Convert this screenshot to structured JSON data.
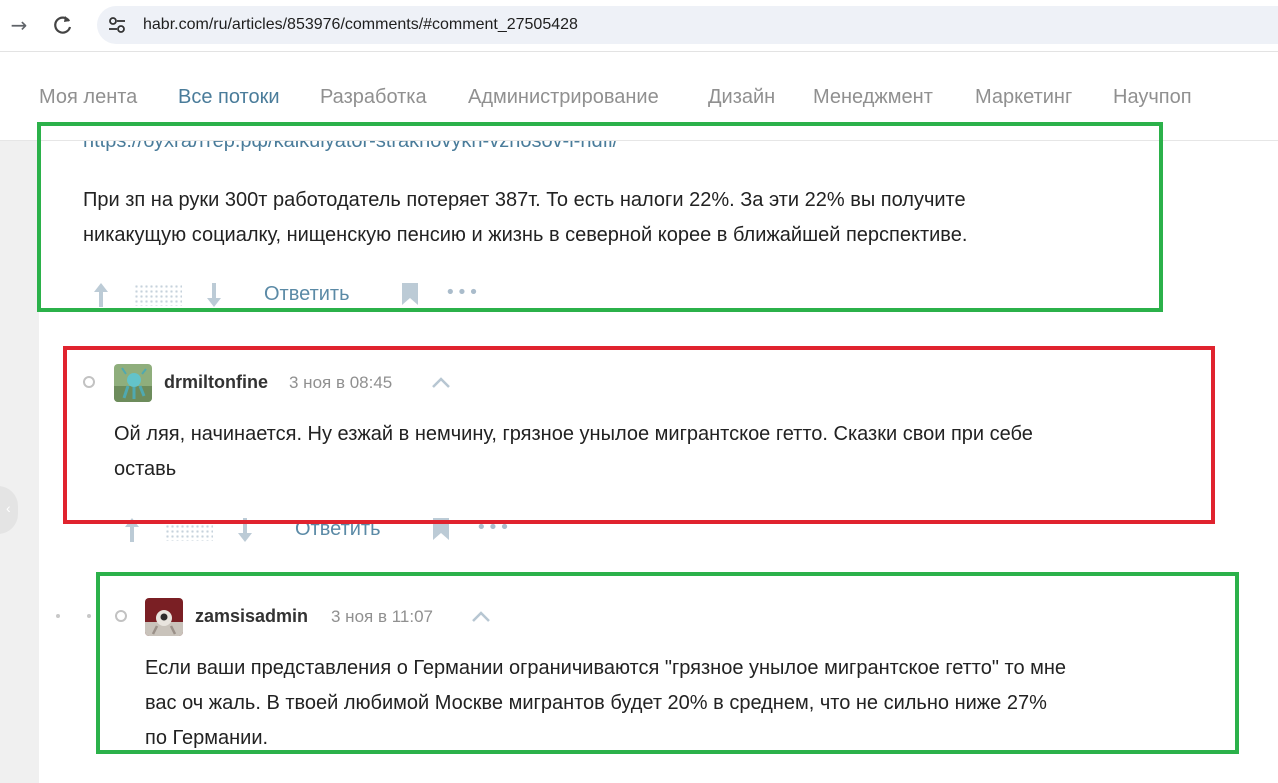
{
  "browser": {
    "url": "habr.com/ru/articles/853976/comments/#comment_27505428",
    "back_icon": "arrow-right-icon",
    "reload_icon": "reload-icon",
    "site_info_icon": "tune-icon"
  },
  "header": {
    "flows": [
      "Моя лента",
      "Все потоки",
      "Разработка",
      "Администрирование",
      "Дизайн",
      "Менеджмент",
      "Маркетинг",
      "Научпоп"
    ],
    "active_flow": "Все потоки"
  },
  "comments": [
    {
      "link": "https://бухгалтер.рф/kalkulyator-strakhovykh-vznosov-i-ndfl/",
      "lines": [
        "При зп на руки 300т работодатель потеряет 387т. То есть налоги 22%. За эти 22% вы получите",
        "никакущую социалку, нищенскую пенсию и жизнь в северной корее в ближайшей перспективе."
      ],
      "reply_label": "Ответить"
    },
    {
      "username": "drmiltonfine",
      "time": "3 ноя в 08:45",
      "lines": [
        "Ой ляя, начинается. Ну езжай в немчину, грязное унылое мигрантское гетто. Сказки свои при себе",
        "оставь"
      ],
      "reply_label": "Ответить"
    },
    {
      "username": "zamsisadmin",
      "time": "3 ноя в 11:07",
      "lines": [
        "Если ваши представления о Германии ограничиваются \"грязное унылое мигрантское гетто\" то мне",
        "вас оч жаль. В твоей любимой Москве мигрантов будет 20% в среднем, что не сильно ниже 27%",
        "по Германии."
      ]
    }
  ],
  "colors": {
    "highlight_green": "#2bb14a",
    "highlight_red": "#e0232e",
    "link": "#4a7c9a",
    "active_flow": "#4a7c9a"
  }
}
